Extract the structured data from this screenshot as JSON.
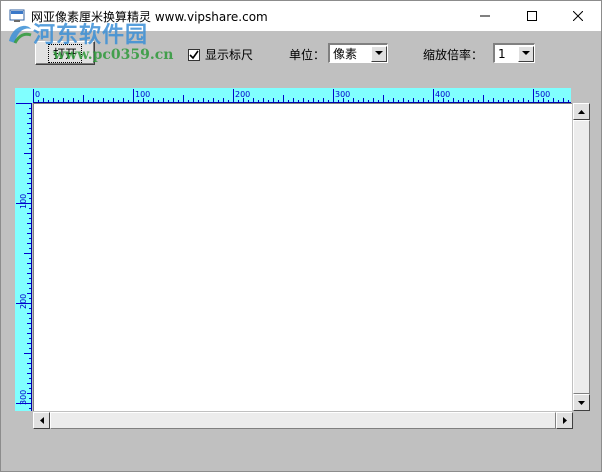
{
  "window": {
    "title": "网亚像素厘米换算精灵 www.vipshare.com"
  },
  "watermark": {
    "text_cn": "河东软件园",
    "text_url": "www.pc0359.cn"
  },
  "toolbar": {
    "open_label": "打开",
    "show_ruler_label": "显示标尺",
    "show_ruler_checked": true,
    "unit_label": "单位：",
    "unit_value": "像素",
    "zoom_label": "缩放倍率：",
    "zoom_value": "1"
  },
  "ruler": {
    "top_labels": [
      "0",
      "100",
      "200",
      "300",
      "400",
      "500"
    ],
    "left_labels": [
      "100",
      "200",
      "300"
    ]
  },
  "colors": {
    "ruler_bg": "#80ffff",
    "ruler_ink": "#0000cc",
    "canvas_bg": "#ffffff",
    "window_bg": "#c0c0c0"
  }
}
